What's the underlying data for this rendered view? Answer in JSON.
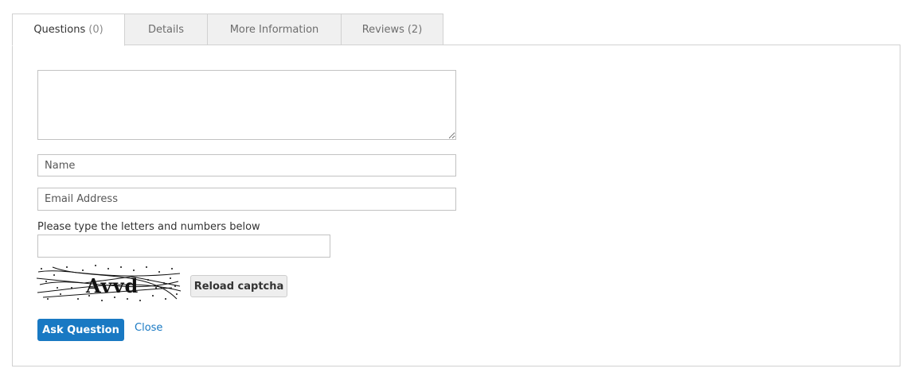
{
  "tabs": [
    {
      "label": "Questions",
      "count": "(0)",
      "active": true
    },
    {
      "label": "Details",
      "count": "",
      "active": false
    },
    {
      "label": "More Information",
      "count": "",
      "active": false
    },
    {
      "label": "Reviews",
      "count": "(2)",
      "active": false
    }
  ],
  "form": {
    "question_value": "",
    "name_placeholder": "Name",
    "email_placeholder": "Email Address",
    "captcha_label": "Please type the letters and numbers below",
    "captcha_value": "",
    "captcha_text": "Avvd",
    "reload_label": "Reload captcha",
    "submit_label": "Ask Question",
    "close_label": "Close"
  },
  "colors": {
    "primary": "#1979c3",
    "tab_bg": "#f0f0f0",
    "border": "#d1d1d1"
  }
}
